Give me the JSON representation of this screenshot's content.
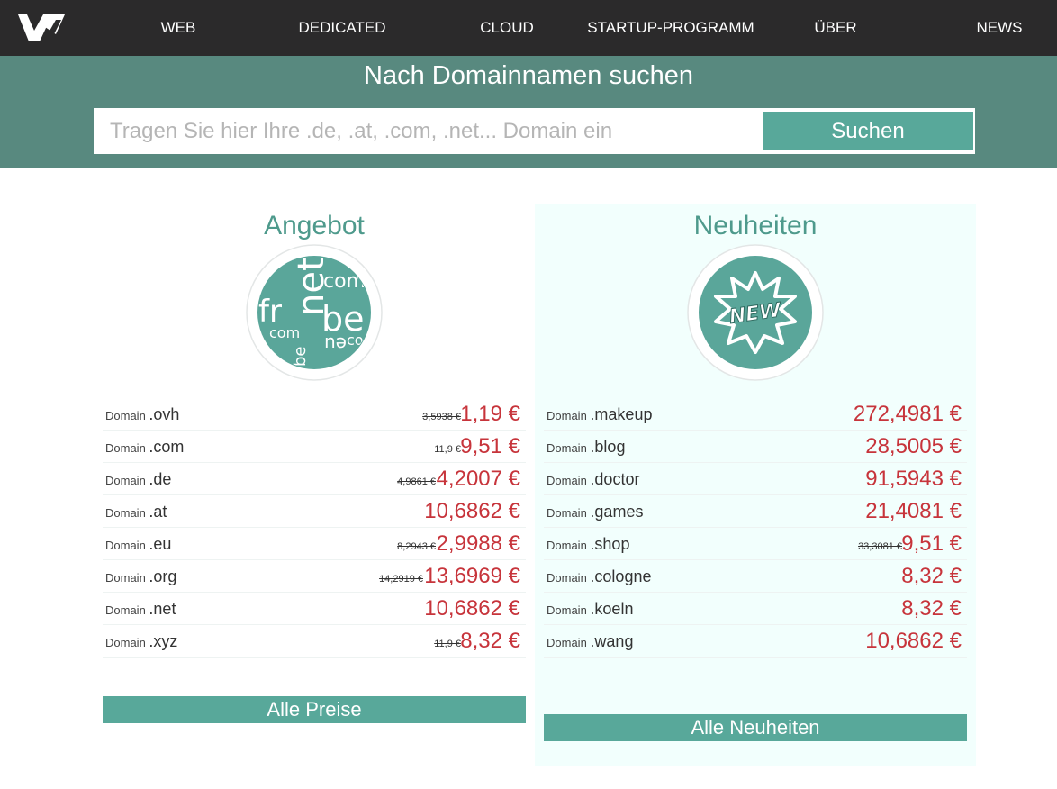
{
  "colors": {
    "nav_bg": "#2b2a2b",
    "banner_bg": "#58897f",
    "accent": "#58a89a",
    "price_red": "#c7343b",
    "title_teal": "#4e9a8c"
  },
  "nav": {
    "logo": "ovh-logo-icon",
    "items": [
      "WEB",
      "DEDICATED",
      "CLOUD",
      "STARTUP-PROGRAMM",
      "ÜBER",
      "NEWS"
    ]
  },
  "search": {
    "title": "Nach Domainnamen suchen",
    "placeholder": "Tragen Sie hier Ihre .de, .at, .com, .net... Domain ein",
    "button_label": "Suchen"
  },
  "offers": {
    "title": "Angebot",
    "badge_icon": "domain-tld-cloud-icon",
    "badge_words": [
      "net",
      "fr",
      "be",
      "com",
      "com",
      "be",
      "eu",
      "co"
    ],
    "domain_prefix": "Domain",
    "items": [
      {
        "tld": ".ovh",
        "old_price": "3,5938 €",
        "price": "1,19 €"
      },
      {
        "tld": ".com",
        "old_price": "11,9 €",
        "price": "9,51 €"
      },
      {
        "tld": ".de",
        "old_price": "4,9861 €",
        "price": "4,2007 €"
      },
      {
        "tld": ".at",
        "old_price": "",
        "price": "10,6862 €"
      },
      {
        "tld": ".eu",
        "old_price": "8,2943 €",
        "price": "2,9988 €"
      },
      {
        "tld": ".org",
        "old_price": "14,2919 €",
        "price": "13,6969 €"
      },
      {
        "tld": ".net",
        "old_price": "",
        "price": "10,6862 €"
      },
      {
        "tld": ".xyz",
        "old_price": "11,9 €",
        "price": "8,32 €"
      }
    ],
    "cta_label": "Alle Preise"
  },
  "news": {
    "title": "Neuheiten",
    "badge_icon": "new-starburst-icon",
    "badge_text": "NEW",
    "domain_prefix": "Domain",
    "items": [
      {
        "tld": ".makeup",
        "old_price": "",
        "price": "272,4981 €"
      },
      {
        "tld": ".blog",
        "old_price": "",
        "price": "28,5005 €"
      },
      {
        "tld": ".doctor",
        "old_price": "",
        "price": "91,5943 €"
      },
      {
        "tld": ".games",
        "old_price": "",
        "price": "21,4081 €"
      },
      {
        "tld": ".shop",
        "old_price": "33,3081 €",
        "price": "9,51 €"
      },
      {
        "tld": ".cologne",
        "old_price": "",
        "price": "8,32 €"
      },
      {
        "tld": ".koeln",
        "old_price": "",
        "price": "8,32 €"
      },
      {
        "tld": ".wang",
        "old_price": "",
        "price": "10,6862 €"
      }
    ],
    "cta_label": "Alle Neuheiten"
  }
}
